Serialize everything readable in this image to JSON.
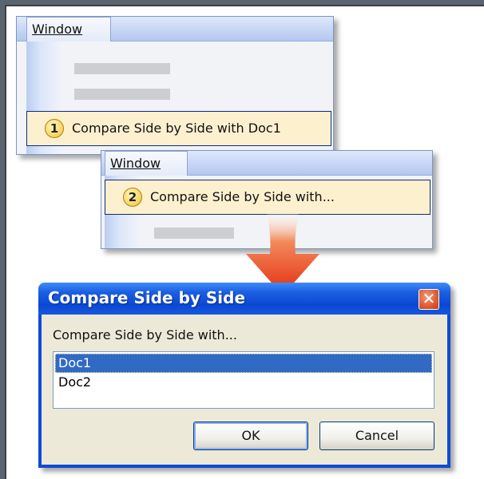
{
  "menu1": {
    "title": "Window",
    "step": "1",
    "item_label": "Compare Side by Side with Doc1"
  },
  "menu2": {
    "title": "Window",
    "step": "2",
    "item_label": "Compare Side by Side with..."
  },
  "dialog": {
    "title": "Compare Side by Side",
    "close_glyph": "✕",
    "prompt": "Compare Side by Side with...",
    "documents": [
      "Doc1",
      "Doc2"
    ],
    "selected": "Doc1",
    "ok_label": "OK",
    "cancel_label": "Cancel"
  },
  "colors": {
    "titlebar": "#0b48d2",
    "highlight_item": "#fdf0cf",
    "selection": "#316ac5",
    "arrow": "#e8401c"
  },
  "icons": [
    "step-one-badge",
    "step-two-badge",
    "down-arrow",
    "close-icon"
  ]
}
